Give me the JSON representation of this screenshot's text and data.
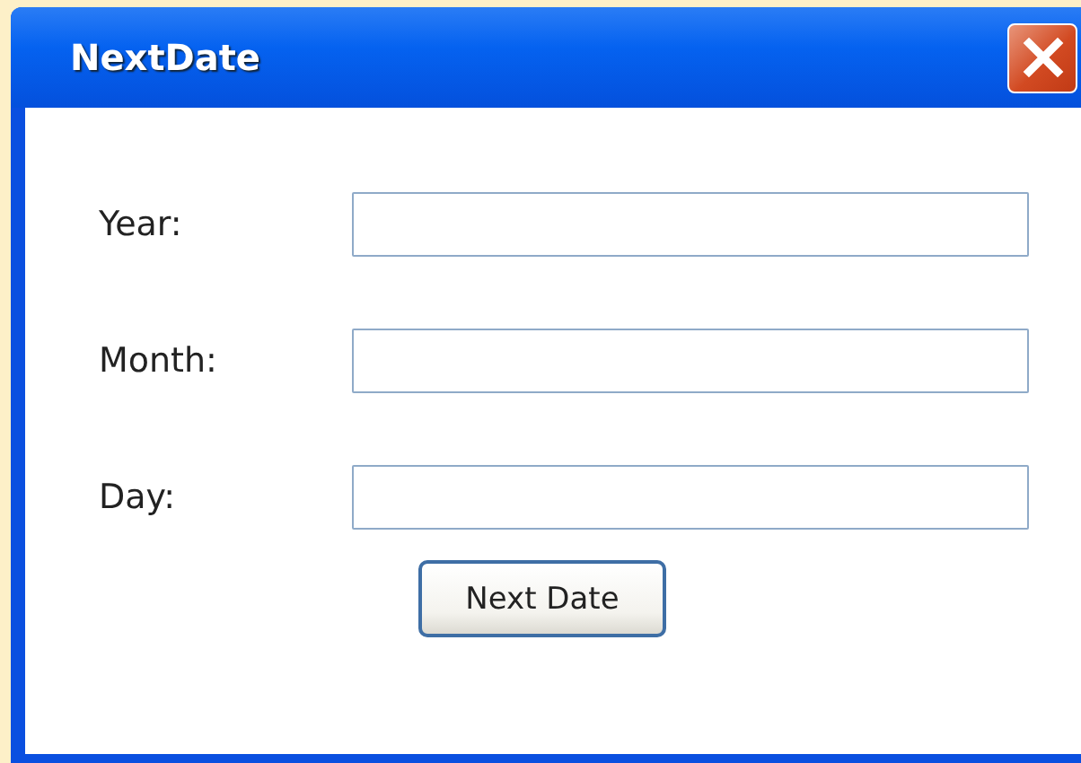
{
  "window": {
    "title": "NextDate"
  },
  "fields": [
    {
      "label": "Year:"
    },
    {
      "label": "Month:"
    },
    {
      "label": "Day:"
    }
  ],
  "buttons": [
    "Next Date"
  ]
}
